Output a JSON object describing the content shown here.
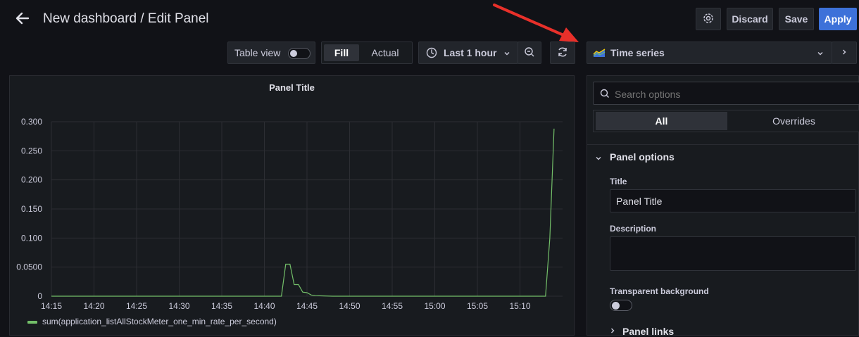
{
  "header": {
    "title": "New dashboard / Edit Panel",
    "discard_label": "Discard",
    "save_label": "Save",
    "apply_label": "Apply"
  },
  "toolbar": {
    "table_view_label": "Table view",
    "table_view_enabled": false,
    "fill_label": "Fill",
    "actual_label": "Actual",
    "selected_mode": "Fill",
    "time_range_label": "Last 1 hour",
    "visualization_label": "Time series"
  },
  "options": {
    "search_placeholder": "Search options",
    "tabs": [
      "All",
      "Overrides"
    ],
    "active_tab": "All",
    "section_title": "Panel options",
    "title_label": "Title",
    "title_value": "Panel Title",
    "description_label": "Description",
    "description_value": "",
    "transparent_label": "Transparent background",
    "transparent_enabled": false,
    "next_section_partial": "Panel links"
  },
  "colors": {
    "background": "#111217",
    "panel": "#181b1f",
    "accent_blue": "#3d71d9",
    "series_green": "#73bf69",
    "annotation_red": "#e8302a"
  },
  "chart_data": {
    "type": "line",
    "title": "Panel Title",
    "x_ticks": [
      "14:15",
      "14:20",
      "14:25",
      "14:30",
      "14:35",
      "14:40",
      "14:45",
      "14:50",
      "14:55",
      "15:00",
      "15:05",
      "15:10"
    ],
    "y_ticks": [
      "0.300",
      "0.250",
      "0.200",
      "0.150",
      "0.100",
      "0.0500",
      "0"
    ],
    "ylim": [
      0,
      0.3
    ],
    "xlim": [
      "14:15",
      "15:15"
    ],
    "grid": true,
    "legend_position": "bottom-left",
    "series": [
      {
        "name": "sum(application_listAllStockMeter_one_min_rate_per_second)",
        "color": "#73bf69",
        "points": [
          [
            "14:15",
            0
          ],
          [
            "14:42",
            0
          ],
          [
            "14:42.5",
            0.055
          ],
          [
            "14:43",
            0.055
          ],
          [
            "14:43.5",
            0.02
          ],
          [
            "14:44",
            0.02
          ],
          [
            "14:44.5",
            0.007
          ],
          [
            "14:45",
            0.006
          ],
          [
            "14:45.5",
            0.002
          ],
          [
            "14:46",
            0.001
          ],
          [
            "14:47",
            0.0005
          ],
          [
            "14:48",
            0
          ],
          [
            "15:13",
            0
          ],
          [
            "15:13.5",
            0.1
          ],
          [
            "15:14",
            0.288
          ]
        ]
      }
    ]
  }
}
